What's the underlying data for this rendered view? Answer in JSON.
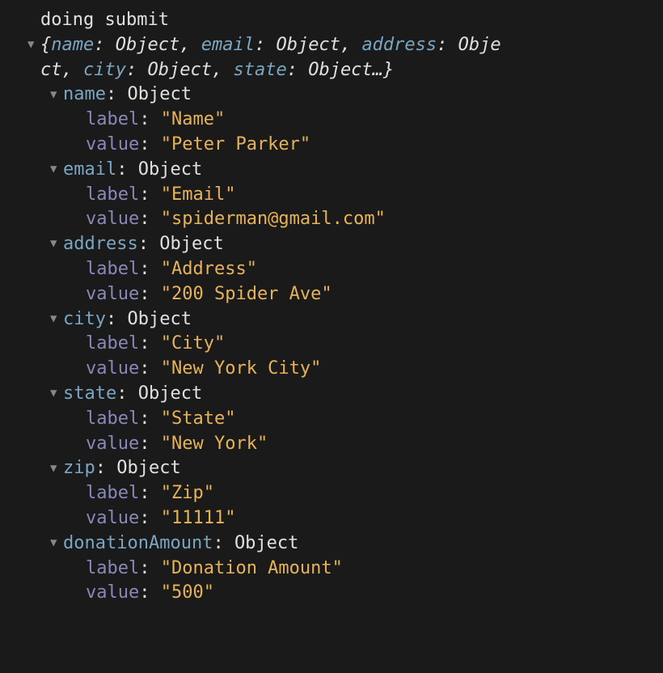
{
  "log": {
    "message": "doing submit",
    "summary": {
      "keys": [
        "name",
        "email",
        "address",
        "city",
        "state"
      ],
      "valueType": "Object",
      "openBrace": "{",
      "closeBrace": "…}",
      "wrapTail": "ct"
    },
    "entries": [
      {
        "key": "name",
        "type": "Object",
        "label": "Name",
        "value": "Peter Parker"
      },
      {
        "key": "email",
        "type": "Object",
        "label": "Email",
        "value": "spiderman@gmail.com"
      },
      {
        "key": "address",
        "type": "Object",
        "label": "Address",
        "value": "200 Spider Ave"
      },
      {
        "key": "city",
        "type": "Object",
        "label": "City",
        "value": "New York City"
      },
      {
        "key": "state",
        "type": "Object",
        "label": "State",
        "value": "New York"
      },
      {
        "key": "zip",
        "type": "Object",
        "label": "Zip",
        "value": "11111"
      },
      {
        "key": "donationAmount",
        "type": "Object",
        "label": "Donation Amount",
        "value": "500"
      }
    ],
    "labels": {
      "labelKey": "label",
      "valueKey": "value"
    }
  }
}
